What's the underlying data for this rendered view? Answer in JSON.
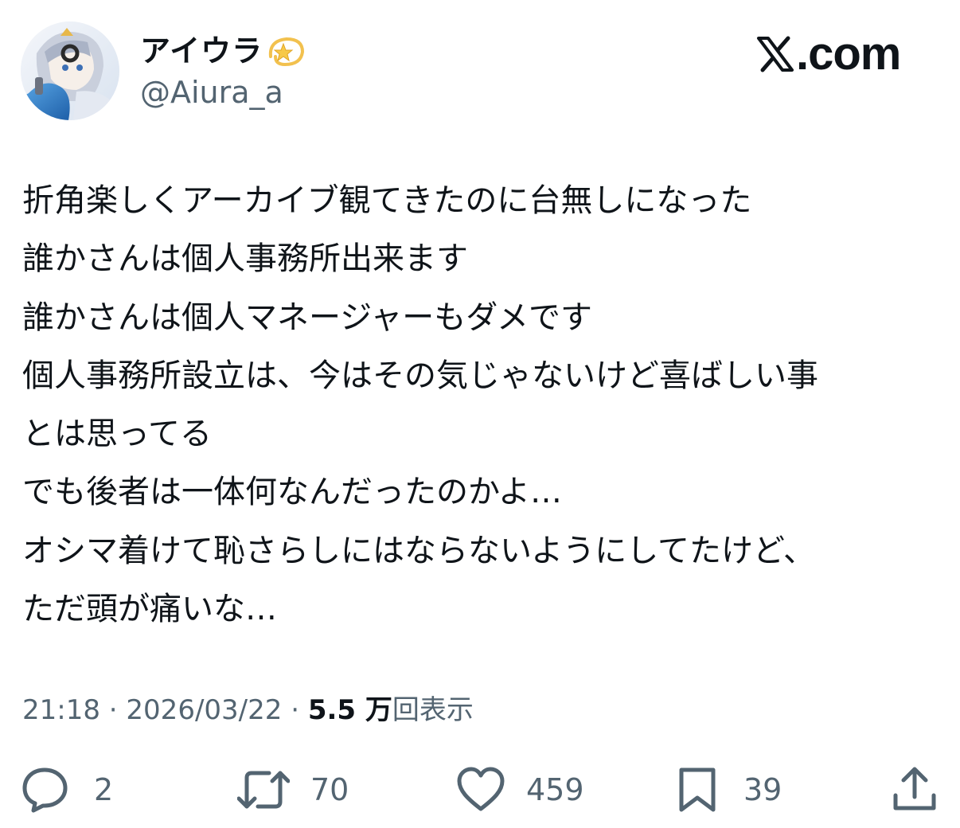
{
  "header": {
    "display_name": "アイウラ",
    "handle": "@Aiura_a",
    "brand": ".com"
  },
  "tweet": {
    "lines": [
      "折角楽しくアーカイブ観てきたのに台無しになった",
      "誰かさんは個人事務所出来ます",
      "誰かさんは個人マネージャーもダメです",
      "個人事務所設立は、今はその気じゃないけど喜ばしい事",
      "とは思ってる",
      "でも後者は一体何なんだったのかよ…",
      "オシマ着けて恥さらしにはならないようにしてたけど、",
      "ただ頭が痛いな…"
    ]
  },
  "meta": {
    "time": "21:18",
    "sep": " · ",
    "date": "2026/03/22",
    "views_count": "5.5 万",
    "views_label": "回表示"
  },
  "actions": {
    "replies": "2",
    "reposts": "70",
    "likes": "459",
    "bookmarks": "39"
  },
  "icons": {
    "avatar": "avatar-icon",
    "sparkle": "dizzy-star-icon",
    "reply": "reply-icon",
    "repost": "repost-icon",
    "like": "heart-icon",
    "bookmark": "bookmark-icon",
    "share": "share-icon"
  },
  "colors": {
    "text": "#0f1419",
    "secondary": "#536471",
    "background": "#ffffff"
  }
}
